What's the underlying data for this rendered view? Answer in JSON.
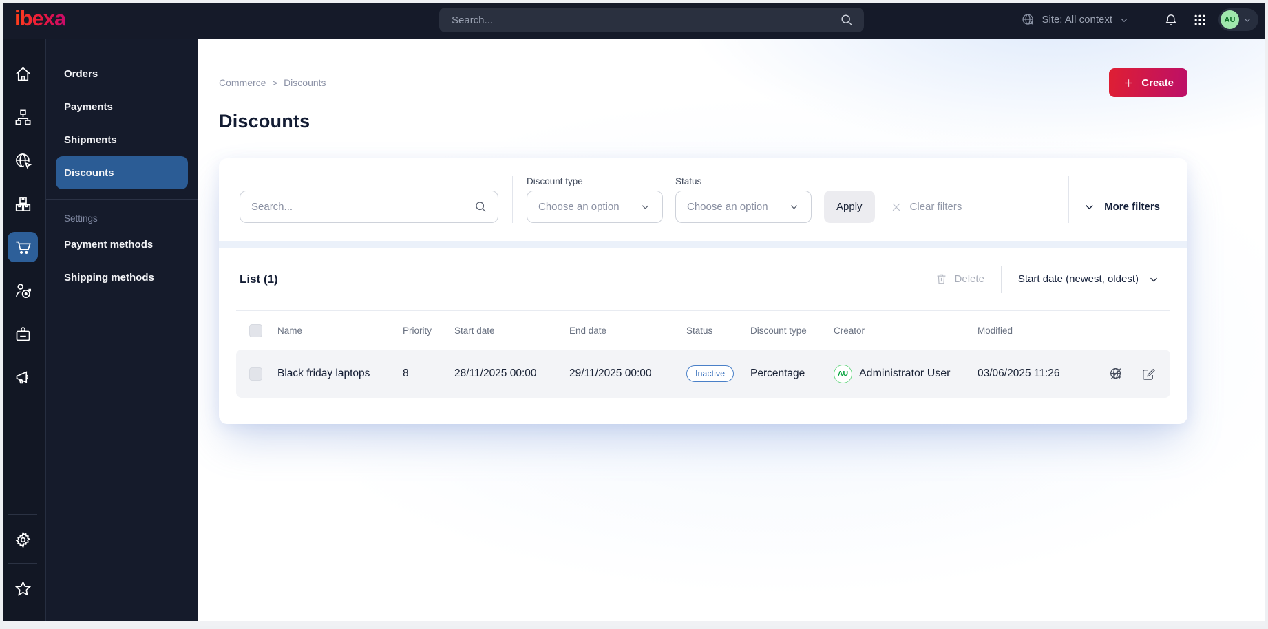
{
  "topbar": {
    "logo": "ibexa",
    "search_placeholder": "Search...",
    "site_context_label": "Site: All context",
    "avatar_initials": "AU"
  },
  "sidebar": {
    "active_item": "commerce",
    "items": [
      {
        "icon": "home"
      },
      {
        "icon": "content-tree"
      },
      {
        "icon": "site"
      },
      {
        "icon": "product-catalog"
      },
      {
        "icon": "commerce"
      },
      {
        "icon": "customers"
      },
      {
        "icon": "corporate"
      },
      {
        "icon": "marketing"
      }
    ],
    "bottom_items": [
      {
        "icon": "settings"
      },
      {
        "icon": "bookmarks"
      }
    ]
  },
  "menu": {
    "items": [
      {
        "label": "Orders",
        "active": false
      },
      {
        "label": "Payments",
        "active": false
      },
      {
        "label": "Shipments",
        "active": false
      },
      {
        "label": "Discounts",
        "active": true
      }
    ],
    "settings_section": {
      "label": "Settings",
      "items": [
        {
          "label": "Payment methods"
        },
        {
          "label": "Shipping methods"
        }
      ]
    }
  },
  "breadcrumb": {
    "items": [
      "Commerce",
      "Discounts"
    ],
    "separator": ">"
  },
  "page": {
    "title": "Discounts"
  },
  "actions": {
    "create_label": "Create"
  },
  "filters": {
    "search_placeholder": "Search...",
    "discount_type": {
      "label": "Discount type",
      "value": "Choose an option"
    },
    "status": {
      "label": "Status",
      "value": "Choose an option"
    },
    "apply_label": "Apply",
    "clear_label": "Clear filters",
    "more_filters_label": "More filters"
  },
  "list": {
    "title": "List (1)",
    "delete_label": "Delete",
    "sort_label": "Start date (newest, oldest)",
    "columns": [
      "Name",
      "Priority",
      "Start date",
      "End date",
      "Status",
      "Discount type",
      "Creator",
      "Modified"
    ],
    "rows": [
      {
        "name": "Black friday laptops",
        "priority": "8",
        "start_date": "28/11/2025 00:00",
        "end_date": "29/11/2025 00:00",
        "status": "Inactive",
        "discount_type": "Percentage",
        "creator": "Administrator User",
        "creator_initials": "AU",
        "modified": "03/06/2025 11:26"
      }
    ]
  },
  "colors": {
    "topbar_bg": "#151a29",
    "active_blue": "#2b5c95",
    "brand_gradient_start": "#ff3d1d",
    "brand_gradient_end": "#c70b6b",
    "badge_blue": "#4a80c8",
    "avatar_green": "#00a23a"
  }
}
